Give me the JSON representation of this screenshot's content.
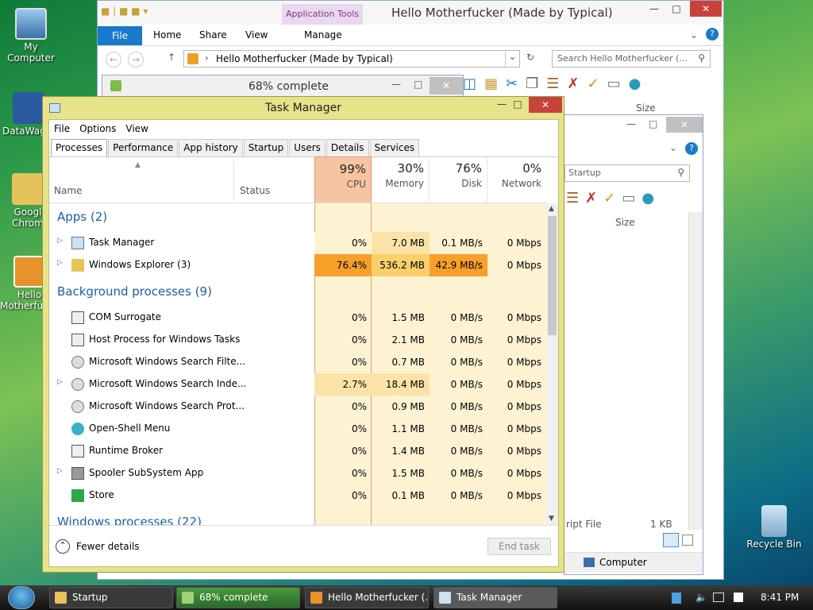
{
  "desktop": {
    "icons": [
      {
        "label1": "My Computer",
        "label2": ""
      },
      {
        "label1": "DataWag",
        "label2": ""
      },
      {
        "label1": "Googl",
        "label2": "Chrom"
      },
      {
        "label1": "Hello",
        "label2": "Motherfucke"
      },
      {
        "label1": "Recycle Bin",
        "label2": ""
      }
    ]
  },
  "explorer": {
    "title": "Hello Motherfucker (Made by Typical)",
    "context_tab": "Application Tools",
    "ribbon_tabs": [
      "File",
      "Home",
      "Share",
      "View",
      "Manage"
    ],
    "address": "Hello Motherfucker (Made by Typical)",
    "search_placeholder": "Search Hello Motherfucker (...",
    "col_size": "Size"
  },
  "progress": {
    "label": "68% complete",
    "percent": 68
  },
  "explorer2": {
    "search_placeholder": "Startup",
    "col_size": "Size",
    "file_type": "ript File",
    "file_size": "1 KB",
    "status": "Computer"
  },
  "taskmanager": {
    "title": "Task Manager",
    "menu": [
      "File",
      "Options",
      "View"
    ],
    "tabs": [
      "Processes",
      "Performance",
      "App history",
      "Startup",
      "Users",
      "Details",
      "Services"
    ],
    "headers": {
      "name": "Name",
      "status": "Status",
      "cpu_pct": "99%",
      "cpu": "CPU",
      "mem_pct": "30%",
      "mem": "Memory",
      "disk_pct": "76%",
      "disk": "Disk",
      "net_pct": "0%",
      "net": "Network"
    },
    "groups": {
      "apps": "Apps (2)",
      "background": "Background processes (9)",
      "windows": "Windows processes (22)"
    },
    "apps": [
      {
        "name": "Task Manager",
        "cpu": "0%",
        "mem": "7.0 MB",
        "disk": "0.1 MB/s",
        "net": "0 Mbps"
      },
      {
        "name": "Windows Explorer (3)",
        "cpu": "76.4%",
        "mem": "536.2 MB",
        "disk": "42.9 MB/s",
        "net": "0 Mbps"
      }
    ],
    "background": [
      {
        "name": "COM Surrogate",
        "cpu": "0%",
        "mem": "1.5 MB",
        "disk": "0 MB/s",
        "net": "0 Mbps"
      },
      {
        "name": "Host Process for Windows Tasks",
        "cpu": "0%",
        "mem": "2.1 MB",
        "disk": "0 MB/s",
        "net": "0 Mbps"
      },
      {
        "name": "Microsoft Windows Search Filte...",
        "cpu": "0%",
        "mem": "0.7 MB",
        "disk": "0 MB/s",
        "net": "0 Mbps"
      },
      {
        "name": "Microsoft Windows Search Inde...",
        "cpu": "2.7%",
        "mem": "18.4 MB",
        "disk": "0 MB/s",
        "net": "0 Mbps"
      },
      {
        "name": "Microsoft Windows Search Prot...",
        "cpu": "0%",
        "mem": "0.9 MB",
        "disk": "0 MB/s",
        "net": "0 Mbps"
      },
      {
        "name": "Open-Shell Menu",
        "cpu": "0%",
        "mem": "1.1 MB",
        "disk": "0 MB/s",
        "net": "0 Mbps"
      },
      {
        "name": "Runtime Broker",
        "cpu": "0%",
        "mem": "1.4 MB",
        "disk": "0 MB/s",
        "net": "0 Mbps"
      },
      {
        "name": "Spooler SubSystem App",
        "cpu": "0%",
        "mem": "1.5 MB",
        "disk": "0 MB/s",
        "net": "0 Mbps"
      },
      {
        "name": "Store",
        "cpu": "0%",
        "mem": "0.1 MB",
        "disk": "0 MB/s",
        "net": "0 Mbps"
      }
    ],
    "footer": {
      "fewer": "Fewer details",
      "end_task": "End task"
    }
  },
  "taskbar": {
    "buttons": [
      "Startup",
      "68% complete",
      "Hello Motherfucker (...",
      "Task Manager"
    ],
    "clock": "8:41 PM"
  }
}
